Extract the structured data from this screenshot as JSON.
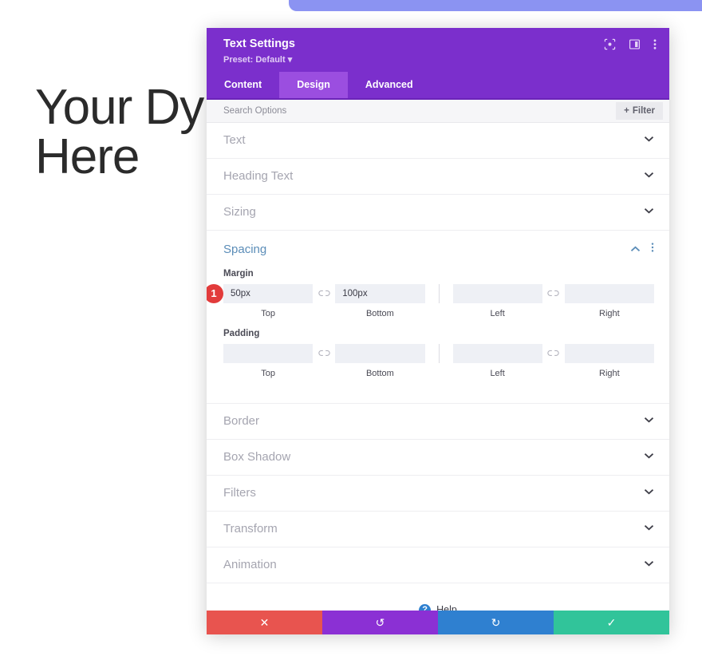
{
  "background": {
    "heading": "Your Dynamic Heading Goes Here",
    "banner_name": "top-banner"
  },
  "modal": {
    "title": "Text Settings",
    "preset": "Preset: Default",
    "header_icons": [
      {
        "name": "focus-target-icon",
        "label": "Focus"
      },
      {
        "name": "split-view-icon",
        "label": "Split View"
      },
      {
        "name": "more-options-icon",
        "label": "More Options"
      }
    ],
    "tabs": [
      {
        "label": "Content",
        "active": false
      },
      {
        "label": "Design",
        "active": true
      },
      {
        "label": "Advanced",
        "active": false
      }
    ],
    "search": {
      "placeholder": "Search Options",
      "value": ""
    },
    "filter_button": {
      "plus": "+",
      "label": "Filter"
    },
    "sections_above": [
      {
        "label": "Text"
      },
      {
        "label": "Heading Text"
      },
      {
        "label": "Sizing"
      }
    ],
    "spacing": {
      "title": "Spacing",
      "margin": {
        "label": "Margin",
        "badge": "1",
        "fields": [
          {
            "caption": "Top",
            "value": "50px",
            "placeholder": ""
          },
          {
            "caption": "Bottom",
            "value": "100px",
            "placeholder": ""
          },
          {
            "caption": "Left",
            "value": "",
            "placeholder": ""
          },
          {
            "caption": "Right",
            "value": "",
            "placeholder": ""
          }
        ]
      },
      "padding": {
        "label": "Padding",
        "fields": [
          {
            "caption": "Top",
            "value": "",
            "placeholder": ""
          },
          {
            "caption": "Bottom",
            "value": "",
            "placeholder": ""
          },
          {
            "caption": "Left",
            "value": "",
            "placeholder": ""
          },
          {
            "caption": "Right",
            "value": "",
            "placeholder": ""
          }
        ]
      }
    },
    "sections_below": [
      {
        "label": "Border"
      },
      {
        "label": "Box Shadow"
      },
      {
        "label": "Filters"
      },
      {
        "label": "Transform"
      },
      {
        "label": "Animation"
      }
    ],
    "help": {
      "icon": "?",
      "label": "Help"
    },
    "footer_buttons": [
      {
        "name": "cancel-button",
        "glyph": "✕",
        "color": "#e8544f"
      },
      {
        "name": "undo-button",
        "glyph": "↺",
        "color": "#8b30d4"
      },
      {
        "name": "redo-button",
        "glyph": "↻",
        "color": "#2f80d0"
      },
      {
        "name": "save-button",
        "glyph": "✓",
        "color": "#31c49a"
      }
    ]
  },
  "colors": {
    "header_purple": "#7b2fcc",
    "tab_active": "#9b4ee0",
    "accent_blue": "#5b8db8",
    "badge_red": "#e23b3b",
    "banner_blue": "#8b93f2"
  }
}
